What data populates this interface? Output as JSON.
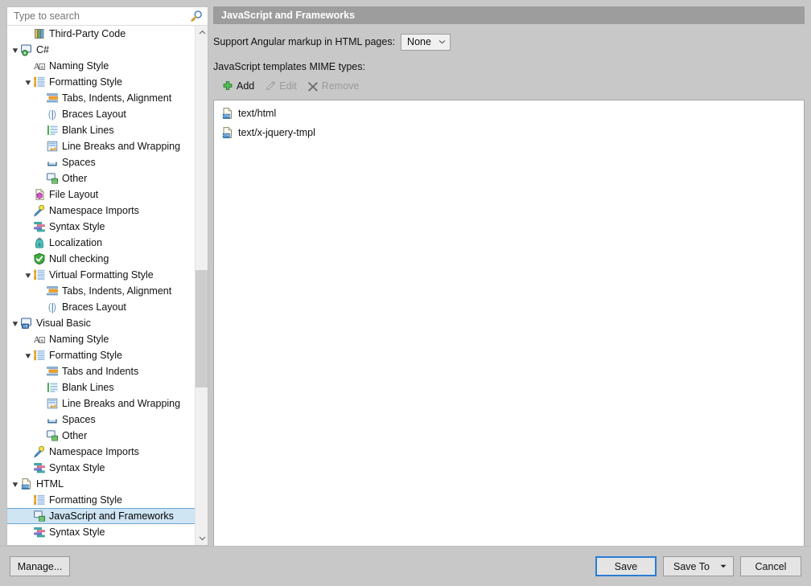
{
  "search": {
    "placeholder": "Type to search",
    "value": "",
    "icon": "search-icon"
  },
  "tree": {
    "items": [
      {
        "label": "Third-Party Code",
        "depth": 2,
        "twisty": "none",
        "icon": "third-party-code-icon",
        "selected": false
      },
      {
        "label": "C#",
        "depth": 1,
        "twisty": "expanded",
        "icon": "csharp-icon",
        "selected": false
      },
      {
        "label": "Naming Style",
        "depth": 2,
        "twisty": "none",
        "icon": "naming-style-icon",
        "selected": false
      },
      {
        "label": "Formatting Style",
        "depth": 2,
        "twisty": "expanded",
        "icon": "formatting-style-icon",
        "selected": false
      },
      {
        "label": "Tabs, Indents, Alignment",
        "depth": 3,
        "twisty": "none",
        "icon": "tabs-indents-icon",
        "selected": false
      },
      {
        "label": "Braces Layout",
        "depth": 3,
        "twisty": "none",
        "icon": "braces-layout-icon",
        "selected": false
      },
      {
        "label": "Blank Lines",
        "depth": 3,
        "twisty": "none",
        "icon": "blank-lines-icon",
        "selected": false
      },
      {
        "label": "Line Breaks and Wrapping",
        "depth": 3,
        "twisty": "none",
        "icon": "line-breaks-icon",
        "selected": false
      },
      {
        "label": "Spaces",
        "depth": 3,
        "twisty": "none",
        "icon": "spaces-icon",
        "selected": false
      },
      {
        "label": "Other",
        "depth": 3,
        "twisty": "none",
        "icon": "other-icon",
        "selected": false
      },
      {
        "label": "File Layout",
        "depth": 2,
        "twisty": "none",
        "icon": "file-layout-icon",
        "selected": false
      },
      {
        "label": "Namespace Imports",
        "depth": 2,
        "twisty": "none",
        "icon": "namespace-imports-icon",
        "selected": false
      },
      {
        "label": "Syntax Style",
        "depth": 2,
        "twisty": "none",
        "icon": "syntax-style-icon",
        "selected": false
      },
      {
        "label": "Localization",
        "depth": 2,
        "twisty": "none",
        "icon": "localization-icon",
        "selected": false
      },
      {
        "label": "Null checking",
        "depth": 2,
        "twisty": "none",
        "icon": "null-checking-icon",
        "selected": false
      },
      {
        "label": "Virtual Formatting Style",
        "depth": 2,
        "twisty": "expanded",
        "icon": "formatting-style-icon",
        "selected": false
      },
      {
        "label": "Tabs, Indents, Alignment",
        "depth": 3,
        "twisty": "none",
        "icon": "tabs-indents-icon",
        "selected": false
      },
      {
        "label": "Braces Layout",
        "depth": 3,
        "twisty": "none",
        "icon": "braces-layout-icon",
        "selected": false
      },
      {
        "label": "Visual Basic",
        "depth": 1,
        "twisty": "expanded",
        "icon": "vb-icon",
        "selected": false
      },
      {
        "label": "Naming Style",
        "depth": 2,
        "twisty": "none",
        "icon": "naming-style-icon",
        "selected": false
      },
      {
        "label": "Formatting Style",
        "depth": 2,
        "twisty": "expanded",
        "icon": "formatting-style-icon",
        "selected": false
      },
      {
        "label": "Tabs and Indents",
        "depth": 3,
        "twisty": "none",
        "icon": "tabs-indents-icon",
        "selected": false
      },
      {
        "label": "Blank Lines",
        "depth": 3,
        "twisty": "none",
        "icon": "blank-lines-icon",
        "selected": false
      },
      {
        "label": "Line Breaks and Wrapping",
        "depth": 3,
        "twisty": "none",
        "icon": "line-breaks-icon",
        "selected": false
      },
      {
        "label": "Spaces",
        "depth": 3,
        "twisty": "none",
        "icon": "spaces-icon",
        "selected": false
      },
      {
        "label": "Other",
        "depth": 3,
        "twisty": "none",
        "icon": "other-icon",
        "selected": false
      },
      {
        "label": "Namespace Imports",
        "depth": 2,
        "twisty": "none",
        "icon": "namespace-imports-icon",
        "selected": false
      },
      {
        "label": "Syntax Style",
        "depth": 2,
        "twisty": "none",
        "icon": "syntax-style-icon",
        "selected": false
      },
      {
        "label": "HTML",
        "depth": 1,
        "twisty": "expanded",
        "icon": "html-icon",
        "selected": false
      },
      {
        "label": "Formatting Style",
        "depth": 2,
        "twisty": "none",
        "icon": "formatting-style-icon",
        "selected": false
      },
      {
        "label": "JavaScript and Frameworks",
        "depth": 2,
        "twisty": "none",
        "icon": "other-icon",
        "selected": true
      },
      {
        "label": "Syntax Style",
        "depth": 2,
        "twisty": "none",
        "icon": "syntax-style-icon",
        "selected": false
      }
    ],
    "scrollbar": {
      "up_arrow": "chevron-up-icon",
      "down_arrow": "chevron-down-icon"
    }
  },
  "panel": {
    "title": "JavaScript and Frameworks",
    "angular_option_label": "Support Angular markup in HTML pages:",
    "angular_option_value": "None",
    "mime_types_label": "JavaScript templates MIME types:",
    "toolbar": {
      "add_label": "Add",
      "edit_label": "Edit",
      "remove_label": "Remove"
    },
    "mime_types": [
      {
        "label": "text/html",
        "icon": "html-file-icon"
      },
      {
        "label": "text/x-jquery-tmpl",
        "icon": "html-file-icon"
      }
    ]
  },
  "footer": {
    "manage_label": "Manage...",
    "save_label": "Save",
    "save_to_label": "Save To",
    "cancel_label": "Cancel"
  },
  "colors": {
    "window_background": "#c8c8c8",
    "panel_header": "#9d9d9d",
    "selection_fill": "#cfe5f4",
    "selection_border": "#6aa7d0",
    "focus_border": "#2b7cd3",
    "accent_green": "#3ea83e"
  }
}
